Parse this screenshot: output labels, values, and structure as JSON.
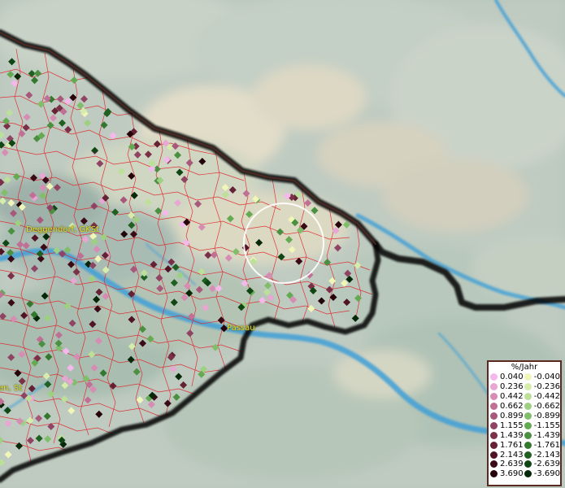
{
  "places": [
    {
      "name": "Deggendorf, GKSt"
    },
    {
      "name": "Passau"
    },
    {
      "name": "en, St"
    }
  ],
  "legend": {
    "title": "%/Jahr",
    "positive": [
      {
        "label": "0.040",
        "color": "#f5b8ec"
      },
      {
        "label": "0.236",
        "color": "#e8a6d2"
      },
      {
        "label": "0.442",
        "color": "#d68cb3"
      },
      {
        "label": "0.662",
        "color": "#c06f95"
      },
      {
        "label": "0.899",
        "color": "#a8587a"
      },
      {
        "label": "1.155",
        "color": "#904464"
      },
      {
        "label": "1.439",
        "color": "#7a3148"
      },
      {
        "label": "1.761",
        "color": "#642234"
      },
      {
        "label": "2.143",
        "color": "#501424"
      },
      {
        "label": "2.639",
        "color": "#3a0a16"
      },
      {
        "label": "3.690",
        "color": "#24040a"
      }
    ],
    "negative": [
      {
        "label": "-0.040",
        "color": "#f0f6b8"
      },
      {
        "label": "-0.236",
        "color": "#d6ecaa"
      },
      {
        "label": "-0.442",
        "color": "#bce09a"
      },
      {
        "label": "-0.662",
        "color": "#9ed082"
      },
      {
        "label": "-0.899",
        "color": "#80be6a"
      },
      {
        "label": "-1.155",
        "color": "#64aa52"
      },
      {
        "label": "-1.439",
        "color": "#4a9040"
      },
      {
        "label": "-1.761",
        "color": "#347830"
      },
      {
        "label": "-2.143",
        "color": "#206020"
      },
      {
        "label": "-2.639",
        "color": "#104614"
      },
      {
        "label": "-3.690",
        "color": "#042808"
      }
    ]
  }
}
